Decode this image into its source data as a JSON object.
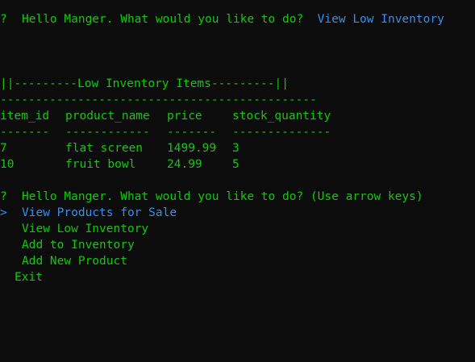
{
  "first_prompt": {
    "mark": "?",
    "question": "Hello Manger. What would you like to do?",
    "answer": "View Low Inventory"
  },
  "low_inventory": {
    "title": "||---------Low Inventory Items---------||",
    "rule": "---------------------------------------------",
    "columns": [
      "item_id",
      "product_name",
      "price",
      "stock_quantity"
    ],
    "column_underlines": [
      "-------",
      "------------",
      "-------",
      "--------------"
    ],
    "rows": [
      [
        "7",
        "flat screen",
        "1499.99",
        "3"
      ],
      [
        "10",
        "fruit bowl",
        "24.99",
        "5"
      ]
    ]
  },
  "second_prompt": {
    "mark": "?",
    "question": "Hello Manger. What would you like to do? (Use arrow keys)",
    "pointer": ">",
    "options": [
      "View Products for Sale",
      "View Low Inventory",
      "Add to Inventory",
      "Add New Product",
      "Exit"
    ]
  },
  "colors": {
    "background": "#0c0c0c",
    "text_green": "#16c60c",
    "highlight_blue": "#3b8eea"
  }
}
